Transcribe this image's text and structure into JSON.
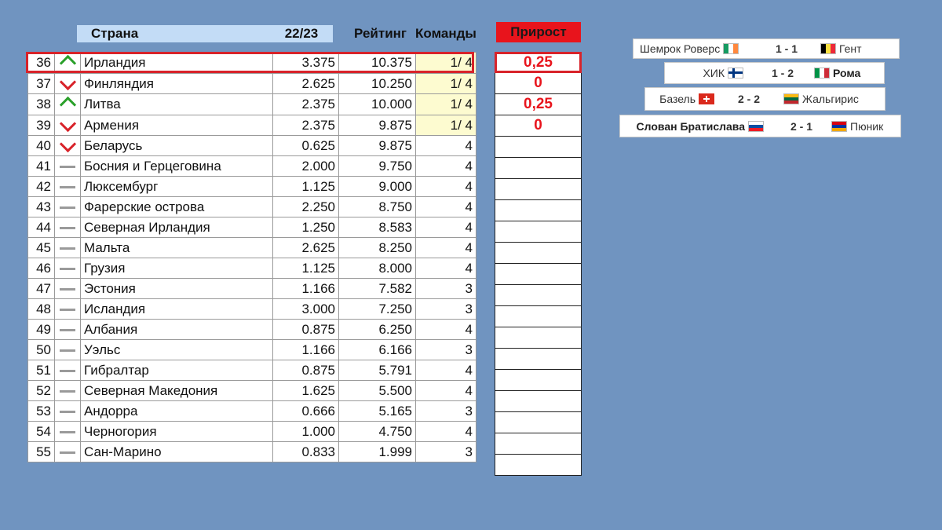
{
  "header": {
    "country": "Страна",
    "season": "22/23",
    "rating": "Рейтинг",
    "teams": "Команды",
    "growth": "Прирост"
  },
  "rows": [
    {
      "pos": "36",
      "trend": "up",
      "country": "Ирландия",
      "season": "3.375",
      "rating": "10.375",
      "teams": "1/ 4",
      "growth": "0,25"
    },
    {
      "pos": "37",
      "trend": "down",
      "country": "Финляндия",
      "season": "2.625",
      "rating": "10.250",
      "teams": "1/ 4",
      "growth": "0"
    },
    {
      "pos": "38",
      "trend": "up",
      "country": "Литва",
      "season": "2.375",
      "rating": "10.000",
      "teams": "1/ 4",
      "growth": "0,25"
    },
    {
      "pos": "39",
      "trend": "down",
      "country": "Армения",
      "season": "2.375",
      "rating": "9.875",
      "teams": "1/ 4",
      "growth": "0"
    },
    {
      "pos": "40",
      "trend": "down",
      "country": "Беларусь",
      "season": "0.625",
      "rating": "9.875",
      "teams": "4",
      "growth": ""
    },
    {
      "pos": "41",
      "trend": "flat",
      "country": "Босния и Герцеговина",
      "season": "2.000",
      "rating": "9.750",
      "teams": "4",
      "growth": ""
    },
    {
      "pos": "42",
      "trend": "flat",
      "country": "Люксембург",
      "season": "1.125",
      "rating": "9.000",
      "teams": "4",
      "growth": ""
    },
    {
      "pos": "43",
      "trend": "flat",
      "country": "Фарерские острова",
      "season": "2.250",
      "rating": "8.750",
      "teams": "4",
      "growth": ""
    },
    {
      "pos": "44",
      "trend": "flat",
      "country": "Северная Ирландия",
      "season": "1.250",
      "rating": "8.583",
      "teams": "4",
      "growth": ""
    },
    {
      "pos": "45",
      "trend": "flat",
      "country": "Мальта",
      "season": "2.625",
      "rating": "8.250",
      "teams": "4",
      "growth": ""
    },
    {
      "pos": "46",
      "trend": "flat",
      "country": "Грузия",
      "season": "1.125",
      "rating": "8.000",
      "teams": "4",
      "growth": ""
    },
    {
      "pos": "47",
      "trend": "flat",
      "country": "Эстония",
      "season": "1.166",
      "rating": "7.582",
      "teams": "3",
      "growth": ""
    },
    {
      "pos": "48",
      "trend": "flat",
      "country": "Исландия",
      "season": "3.000",
      "rating": "7.250",
      "teams": "3",
      "growth": ""
    },
    {
      "pos": "49",
      "trend": "flat",
      "country": "Албания",
      "season": "0.875",
      "rating": "6.250",
      "teams": "4",
      "growth": ""
    },
    {
      "pos": "50",
      "trend": "flat",
      "country": "Уэльс",
      "season": "1.166",
      "rating": "6.166",
      "teams": "3",
      "growth": ""
    },
    {
      "pos": "51",
      "trend": "flat",
      "country": "Гибралтар",
      "season": "0.875",
      "rating": "5.791",
      "teams": "4",
      "growth": ""
    },
    {
      "pos": "52",
      "trend": "flat",
      "country": "Северная Македония",
      "season": "1.625",
      "rating": "5.500",
      "teams": "4",
      "growth": ""
    },
    {
      "pos": "53",
      "trend": "flat",
      "country": "Андорра",
      "season": "0.666",
      "rating": "5.165",
      "teams": "3",
      "growth": ""
    },
    {
      "pos": "54",
      "trend": "flat",
      "country": "Черногория",
      "season": "1.000",
      "rating": "4.750",
      "teams": "4",
      "growth": ""
    },
    {
      "pos": "55",
      "trend": "flat",
      "country": "Сан-Марино",
      "season": "0.833",
      "rating": "1.999",
      "teams": "3",
      "growth": ""
    }
  ],
  "matches": [
    {
      "home": "Шемрок Роверс",
      "home_flag": "ie",
      "score": "1 - 1",
      "away": "Гент",
      "away_flag": "be",
      "bold": "none"
    },
    {
      "home": "ХИК",
      "home_flag": "fi",
      "score": "1 - 2",
      "away": "Рома",
      "away_flag": "it",
      "bold": "away"
    },
    {
      "home": "Базель",
      "home_flag": "ch",
      "score": "2 - 2",
      "away": "Жальгирис",
      "away_flag": "lt",
      "bold": "none"
    },
    {
      "home": "Слован Братислава",
      "home_flag": "sk",
      "score": "2 - 1",
      "away": "Пюник",
      "away_flag": "am",
      "bold": "home"
    }
  ],
  "colors": {
    "background": "#7094c0",
    "accent": "#e8141c",
    "header": "#c3dcf6",
    "highlight": "#fdfbd0"
  }
}
